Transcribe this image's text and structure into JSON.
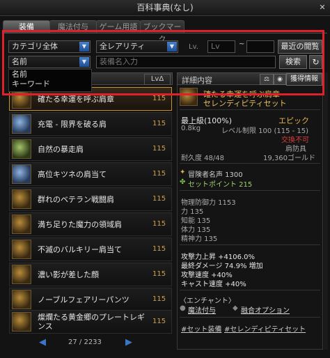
{
  "window": {
    "title": "百科事典(なし)",
    "close_label": "✕"
  },
  "tabs": [
    {
      "label": "装備",
      "active": true
    },
    {
      "label": "魔法付与",
      "active": false
    },
    {
      "label": "ゲーム用語",
      "active": false
    },
    {
      "label": "ブックマーク",
      "active": false
    }
  ],
  "filters": {
    "category": "カテゴリ全体",
    "rarity": "全レアリティ",
    "lv_label": "Lv.",
    "lv_placeholder": "Lv",
    "tilde": "~",
    "recent_button": "最近の閲覧",
    "search_type": "名前",
    "name_placeholder": "装備名入力",
    "search_button": "検索",
    "refresh_icon": "refresh-icon"
  },
  "search_type_options": [
    "名前",
    "キーワード"
  ],
  "list": {
    "column_lv": "LvΔ",
    "items": [
      {
        "name": "確たる幸運を呼ぶ肩章",
        "lv": "115",
        "selected": true,
        "icon": "gold"
      },
      {
        "name": "充電 - 限界を破る肩",
        "lv": "115",
        "selected": false,
        "icon": "blue"
      },
      {
        "name": "自然の暴走肩",
        "lv": "115",
        "selected": false,
        "icon": "green"
      },
      {
        "name": "高位キツネの肩当て",
        "lv": "115",
        "selected": false,
        "icon": "blue"
      },
      {
        "name": "群れのベテラン戦闘肩",
        "lv": "115",
        "selected": false,
        "icon": "gold"
      },
      {
        "name": "満ち足りた魔力の領域肩",
        "lv": "115",
        "selected": false,
        "icon": "gold"
      },
      {
        "name": "不滅のバルキリー肩当て",
        "lv": "115",
        "selected": false,
        "icon": "gold"
      },
      {
        "name": "濃い影が差した顔",
        "lv": "115",
        "selected": false,
        "icon": "gold"
      },
      {
        "name": "ノーブルフェアリーパンツ",
        "lv": "115",
        "selected": false,
        "icon": "gold"
      },
      {
        "name": "燦爛たる黄金郷のプレートレギンス",
        "lv": "115",
        "selected": false,
        "icon": "gold"
      }
    ]
  },
  "pager": {
    "text": "27 / 2233",
    "prev": "◀",
    "next": "▶"
  },
  "detail": {
    "header": "詳細内容",
    "obtain_button": "獲得情報",
    "item_name": "確たる幸運を呼ぶ肩章",
    "set_name": "セレンディピティセット",
    "grade": "最上級(100%)",
    "rarity": "エピック",
    "weight": "0.8kg",
    "level_req": "レベル制限 100 (115 - 15)",
    "trade": "交換不可",
    "slot": "肩防具",
    "durability": "耐久度 48/48",
    "price": "19,360ゴールド",
    "adventurer_fame": "冒険者名声 1300",
    "set_point": "セットポイント 215",
    "stats": [
      "物理防御力 1153",
      "力 135",
      "知能 135",
      "体力 135",
      "精神力 135"
    ],
    "options": [
      "攻撃力上昇 +4106.0%",
      "最終ダメージ 74.9% 増加",
      "攻撃速度 +40%",
      "キャスト速度 +40%"
    ],
    "enchant_header": "〈エンチャント〉",
    "enchant_magic": "魔法付与",
    "enchant_fusion": "融合オプション",
    "tags": [
      "#セット装備",
      "#セレンディピティセット"
    ]
  },
  "colors": {
    "accent_gold": "#d0a050",
    "red_highlight": "#e0202b",
    "blue_arrow": "#2f63b0"
  }
}
